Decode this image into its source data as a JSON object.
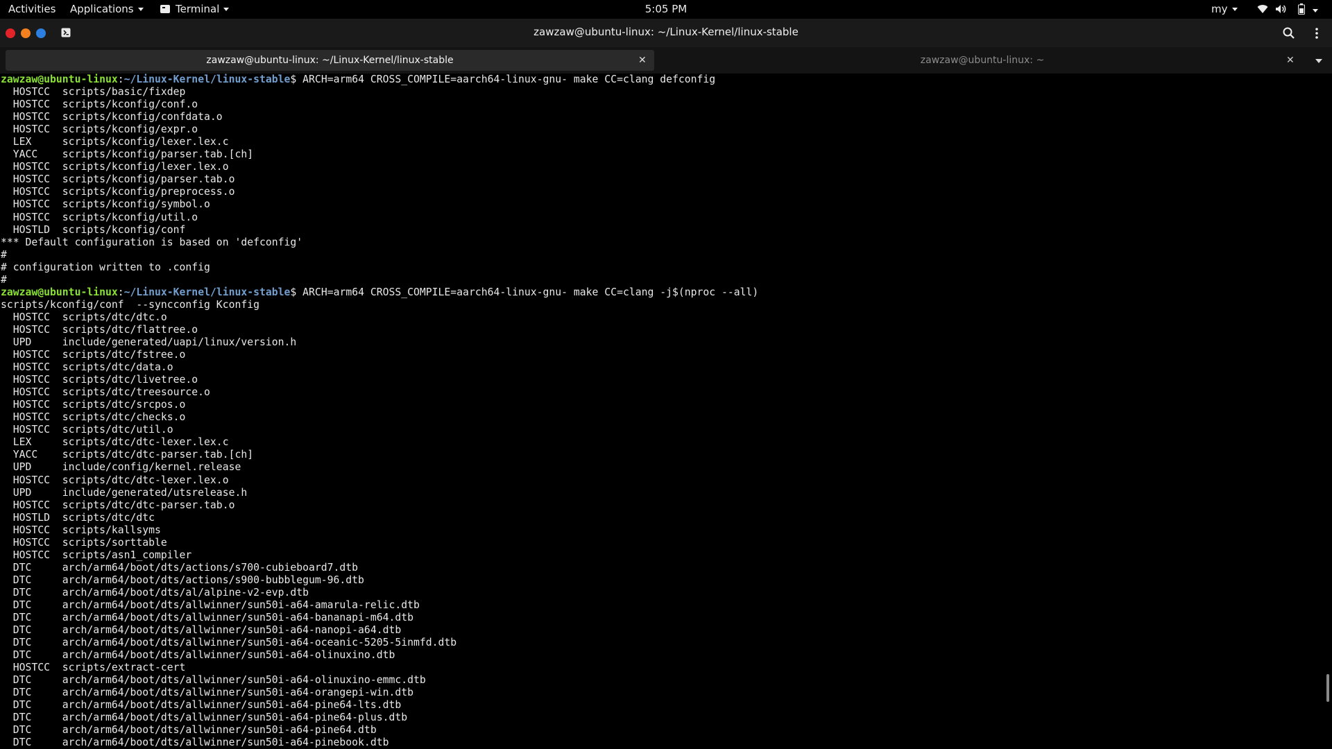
{
  "topbar": {
    "activities": "Activities",
    "applications": "Applications",
    "terminal_menu": "Terminal",
    "clock": "5:05 PM",
    "keyboard_layout": "my",
    "icons": [
      "wifi-icon",
      "volume-icon",
      "battery-icon",
      "chevron-down-icon"
    ]
  },
  "window": {
    "title": "zawzaw@ubuntu-linux: ~/Linux-Kernel/linux-stable",
    "controls": {
      "close_color": "#e2242a",
      "minimize_color": "#f4801f",
      "maximize_color": "#2c7ee0"
    }
  },
  "tabs": [
    {
      "label": "zawzaw@ubuntu-linux: ~/Linux-Kernel/linux-stable",
      "active": true
    },
    {
      "label": "zawzaw@ubuntu-linux: ~",
      "active": false
    }
  ],
  "colors": {
    "prompt_user": "#8ae234",
    "prompt_path": "#729fcf",
    "text": "#e8e8e8",
    "background": "#000000"
  },
  "terminal": {
    "prompt_user": "zawzaw@ubuntu-linux",
    "prompt_separator": ":",
    "prompt_path": "~/Linux-Kernel/linux-stable",
    "prompt_symbol": "$ ",
    "lines": [
      {
        "type": "prompt",
        "command": "ARCH=arm64 CROSS_COMPILE=aarch64-linux-gnu- make CC=clang defconfig"
      },
      {
        "text": "  HOSTCC  scripts/basic/fixdep"
      },
      {
        "text": "  HOSTCC  scripts/kconfig/conf.o"
      },
      {
        "text": "  HOSTCC  scripts/kconfig/confdata.o"
      },
      {
        "text": "  HOSTCC  scripts/kconfig/expr.o"
      },
      {
        "text": "  LEX     scripts/kconfig/lexer.lex.c"
      },
      {
        "text": "  YACC    scripts/kconfig/parser.tab.[ch]"
      },
      {
        "text": "  HOSTCC  scripts/kconfig/lexer.lex.o"
      },
      {
        "text": "  HOSTCC  scripts/kconfig/parser.tab.o"
      },
      {
        "text": "  HOSTCC  scripts/kconfig/preprocess.o"
      },
      {
        "text": "  HOSTCC  scripts/kconfig/symbol.o"
      },
      {
        "text": "  HOSTCC  scripts/kconfig/util.o"
      },
      {
        "text": "  HOSTLD  scripts/kconfig/conf"
      },
      {
        "text": "*** Default configuration is based on 'defconfig'"
      },
      {
        "text": "#"
      },
      {
        "text": "# configuration written to .config"
      },
      {
        "text": "#"
      },
      {
        "type": "prompt",
        "command": "ARCH=arm64 CROSS_COMPILE=aarch64-linux-gnu- make CC=clang -j$(nproc --all)"
      },
      {
        "text": "scripts/kconfig/conf  --syncconfig Kconfig"
      },
      {
        "text": "  HOSTCC  scripts/dtc/dtc.o"
      },
      {
        "text": "  HOSTCC  scripts/dtc/flattree.o"
      },
      {
        "text": "  UPD     include/generated/uapi/linux/version.h"
      },
      {
        "text": "  HOSTCC  scripts/dtc/fstree.o"
      },
      {
        "text": "  HOSTCC  scripts/dtc/data.o"
      },
      {
        "text": "  HOSTCC  scripts/dtc/livetree.o"
      },
      {
        "text": "  HOSTCC  scripts/dtc/treesource.o"
      },
      {
        "text": "  HOSTCC  scripts/dtc/srcpos.o"
      },
      {
        "text": "  HOSTCC  scripts/dtc/checks.o"
      },
      {
        "text": "  HOSTCC  scripts/dtc/util.o"
      },
      {
        "text": "  LEX     scripts/dtc/dtc-lexer.lex.c"
      },
      {
        "text": "  YACC    scripts/dtc/dtc-parser.tab.[ch]"
      },
      {
        "text": "  UPD     include/config/kernel.release"
      },
      {
        "text": "  HOSTCC  scripts/dtc/dtc-lexer.lex.o"
      },
      {
        "text": "  UPD     include/generated/utsrelease.h"
      },
      {
        "text": "  HOSTCC  scripts/dtc/dtc-parser.tab.o"
      },
      {
        "text": "  HOSTLD  scripts/dtc/dtc"
      },
      {
        "text": "  HOSTCC  scripts/kallsyms"
      },
      {
        "text": "  HOSTCC  scripts/sorttable"
      },
      {
        "text": "  HOSTCC  scripts/asn1_compiler"
      },
      {
        "text": "  DTC     arch/arm64/boot/dts/actions/s700-cubieboard7.dtb"
      },
      {
        "text": "  DTC     arch/arm64/boot/dts/actions/s900-bubblegum-96.dtb"
      },
      {
        "text": "  DTC     arch/arm64/boot/dts/al/alpine-v2-evp.dtb"
      },
      {
        "text": "  DTC     arch/arm64/boot/dts/allwinner/sun50i-a64-amarula-relic.dtb"
      },
      {
        "text": "  DTC     arch/arm64/boot/dts/allwinner/sun50i-a64-bananapi-m64.dtb"
      },
      {
        "text": "  DTC     arch/arm64/boot/dts/allwinner/sun50i-a64-nanopi-a64.dtb"
      },
      {
        "text": "  DTC     arch/arm64/boot/dts/allwinner/sun50i-a64-oceanic-5205-5inmfd.dtb"
      },
      {
        "text": "  DTC     arch/arm64/boot/dts/allwinner/sun50i-a64-olinuxino.dtb"
      },
      {
        "text": "  HOSTCC  scripts/extract-cert"
      },
      {
        "text": "  DTC     arch/arm64/boot/dts/allwinner/sun50i-a64-olinuxino-emmc.dtb"
      },
      {
        "text": "  DTC     arch/arm64/boot/dts/allwinner/sun50i-a64-orangepi-win.dtb"
      },
      {
        "text": "  DTC     arch/arm64/boot/dts/allwinner/sun50i-a64-pine64-lts.dtb"
      },
      {
        "text": "  DTC     arch/arm64/boot/dts/allwinner/sun50i-a64-pine64-plus.dtb"
      },
      {
        "text": "  DTC     arch/arm64/boot/dts/allwinner/sun50i-a64-pine64.dtb"
      },
      {
        "text": "  DTC     arch/arm64/boot/dts/allwinner/sun50i-a64-pinebook.dtb"
      }
    ]
  }
}
